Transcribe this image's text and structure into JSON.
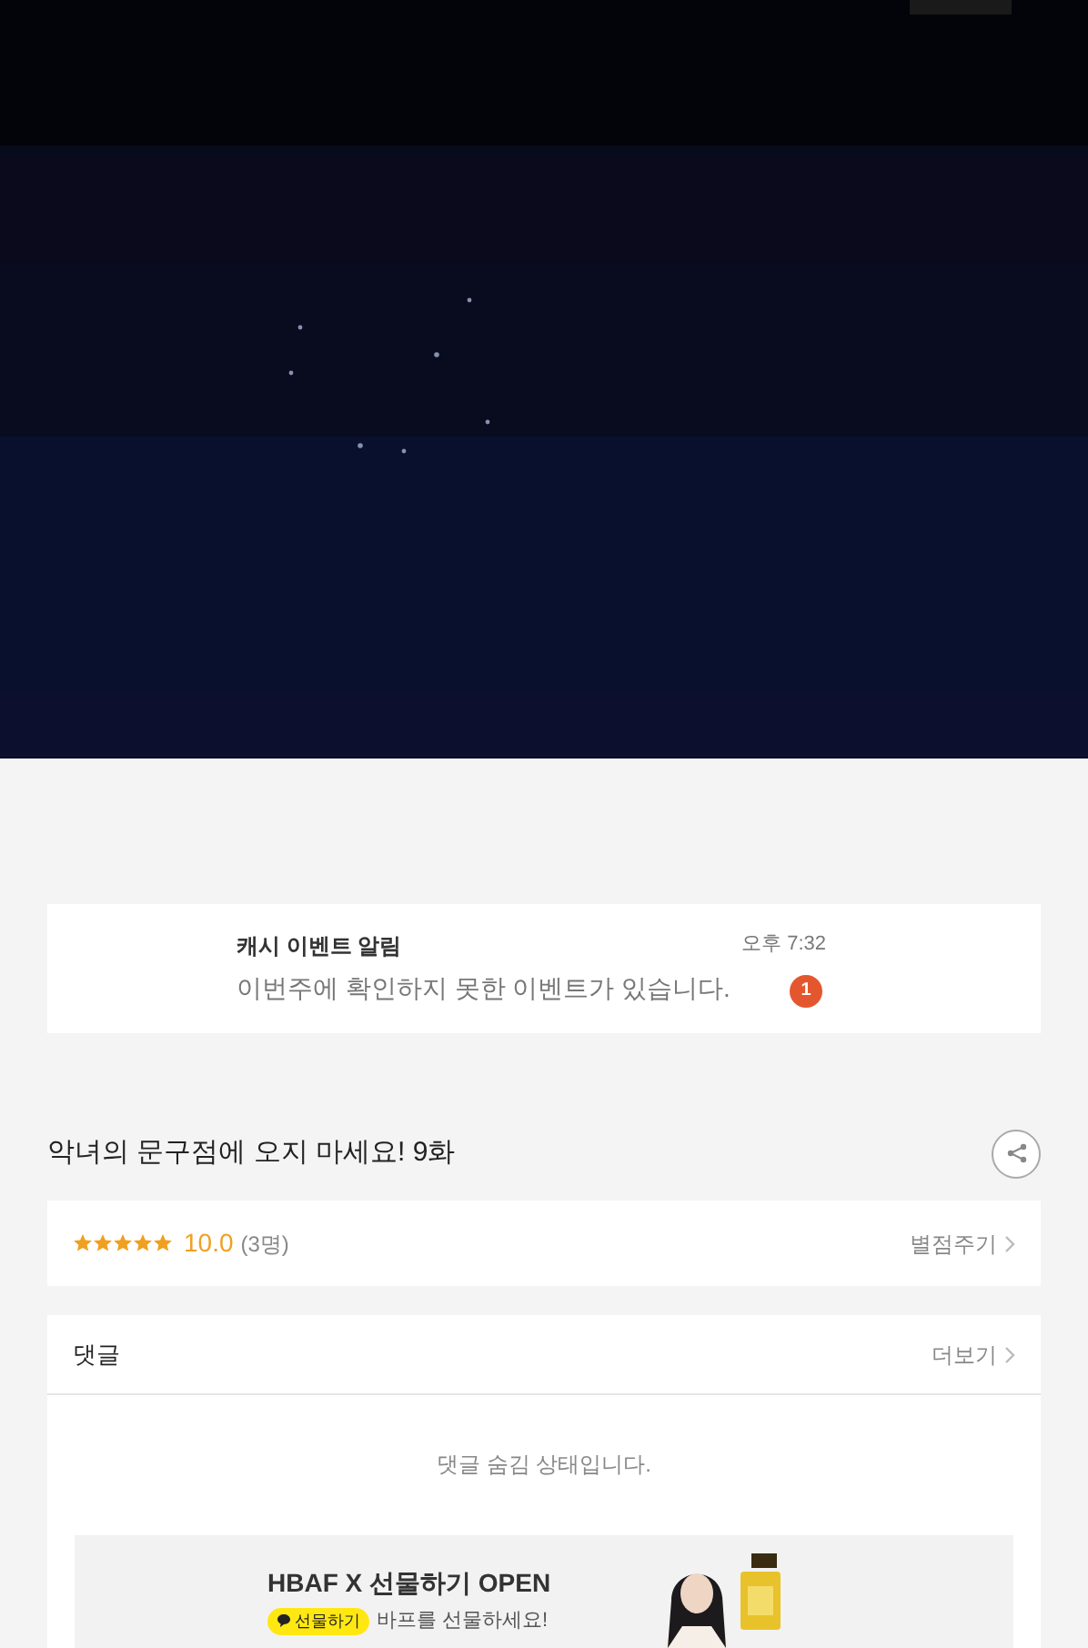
{
  "notification": {
    "title": "캐시 이벤트 알림",
    "message": "이번주에 확인하지 못한 이벤트가 있습니다.",
    "time": "오후 7:32",
    "badge": "1"
  },
  "episode": {
    "title": "악녀의 문구점에 오지 마세요! 9화"
  },
  "rating": {
    "stars": 5,
    "score": "10.0",
    "count": "(3명)",
    "action": "별점주기"
  },
  "comments": {
    "title": "댓글",
    "more": "더보기",
    "notice": "댓글 숨김 상태입니다."
  },
  "ad": {
    "headline": "HBAF X 선물하기 OPEN",
    "tag": "선물하기",
    "text": "바프를 선물하세요!"
  }
}
